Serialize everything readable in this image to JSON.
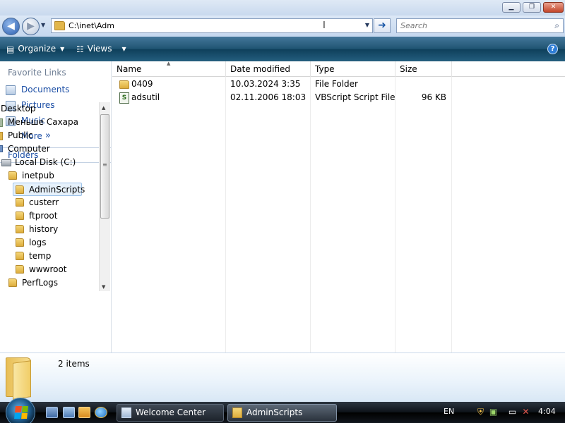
{
  "window": {
    "minimize_glyph": "▁",
    "maximize_glyph": "❐",
    "close_glyph": "✕"
  },
  "address_bar": {
    "path": "C:\\inet\\Adm",
    "cursor_glyph": "I",
    "dropdown_glyph": "▼",
    "go_glyph": "➜"
  },
  "search": {
    "placeholder": "Search",
    "icon": "search-icon"
  },
  "toolbar": {
    "organize_label": "Organize",
    "views_label": "Views",
    "help_label": "?"
  },
  "favorite_links": {
    "title": "Favorite Links",
    "items": [
      {
        "label": "Documents",
        "icon": "documents-icon"
      },
      {
        "label": "Pictures",
        "icon": "pictures-icon"
      },
      {
        "label": "Music",
        "icon": "music-icon"
      },
      {
        "label": "More",
        "icon": "more-chevron-icon"
      }
    ],
    "more_glyph": "»"
  },
  "folders_pane": {
    "title": "Folders",
    "tree": [
      {
        "label": "Desktop",
        "level": 0,
        "icon": "desktop-icon"
      },
      {
        "label": "Меньше Сахара",
        "level": 0,
        "icon": "user-folder-icon"
      },
      {
        "label": "Public",
        "level": 0,
        "icon": "public-folder-icon"
      },
      {
        "label": "Computer",
        "level": 0,
        "icon": "computer-icon"
      },
      {
        "label": "Local Disk (C:)",
        "level": 1,
        "icon": "drive-icon"
      },
      {
        "label": "inetpub",
        "level": 2,
        "icon": "folder-icon"
      },
      {
        "label": "AdminScripts",
        "level": 3,
        "icon": "folder-icon",
        "selected": true
      },
      {
        "label": "custerr",
        "level": 3,
        "icon": "folder-icon"
      },
      {
        "label": "ftproot",
        "level": 3,
        "icon": "folder-icon"
      },
      {
        "label": "history",
        "level": 3,
        "icon": "folder-icon"
      },
      {
        "label": "logs",
        "level": 3,
        "icon": "folder-icon"
      },
      {
        "label": "temp",
        "level": 3,
        "icon": "folder-icon"
      },
      {
        "label": "wwwroot",
        "level": 3,
        "icon": "folder-icon"
      },
      {
        "label": "PerfLogs",
        "level": 2,
        "icon": "folder-icon"
      }
    ]
  },
  "file_list": {
    "columns": [
      "Name",
      "Date modified",
      "Type",
      "Size"
    ],
    "rows": [
      {
        "name": "0409",
        "date": "10.03.2024 3:35",
        "type": "File Folder",
        "size": "",
        "icon": "folder-icon"
      },
      {
        "name": "adsutil",
        "date": "02.11.2006 18:03",
        "type": "VBScript Script File",
        "size": "96 KB",
        "icon": "script-icon"
      }
    ]
  },
  "details": {
    "count": "2 items"
  },
  "taskbar": {
    "tasks": [
      {
        "label": "Welcome Center",
        "icon": "welcome-center-icon"
      },
      {
        "label": "AdminScripts",
        "icon": "folder-icon"
      }
    ],
    "language": "EN",
    "clock": "4:04"
  }
}
